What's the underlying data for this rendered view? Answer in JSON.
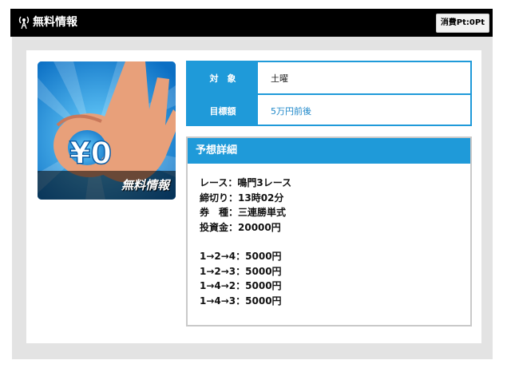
{
  "header": {
    "title": "無料情報",
    "points_badge": "消費Pt:0Pt"
  },
  "thumbnail": {
    "big_text": "¥0",
    "overlay_label": "無料情報"
  },
  "info_table": {
    "rows": [
      {
        "key": "対　象",
        "value": "土曜"
      },
      {
        "key": "目標額",
        "value": "5万円前後"
      }
    ]
  },
  "detail": {
    "heading": "予想詳細",
    "lines": [
      "レース：鳴門3レース",
      "締切り：13時02分",
      "券　種：三連勝単式",
      "投資金：20000円"
    ],
    "bets": [
      "1→2→4：5000円",
      "1→2→3：5000円",
      "1→4→2：5000円",
      "1→4→3：5000円"
    ]
  },
  "colors": {
    "accent": "#1f9ad9",
    "header_bg": "#000000",
    "panel_bg": "#e3e3e3"
  }
}
